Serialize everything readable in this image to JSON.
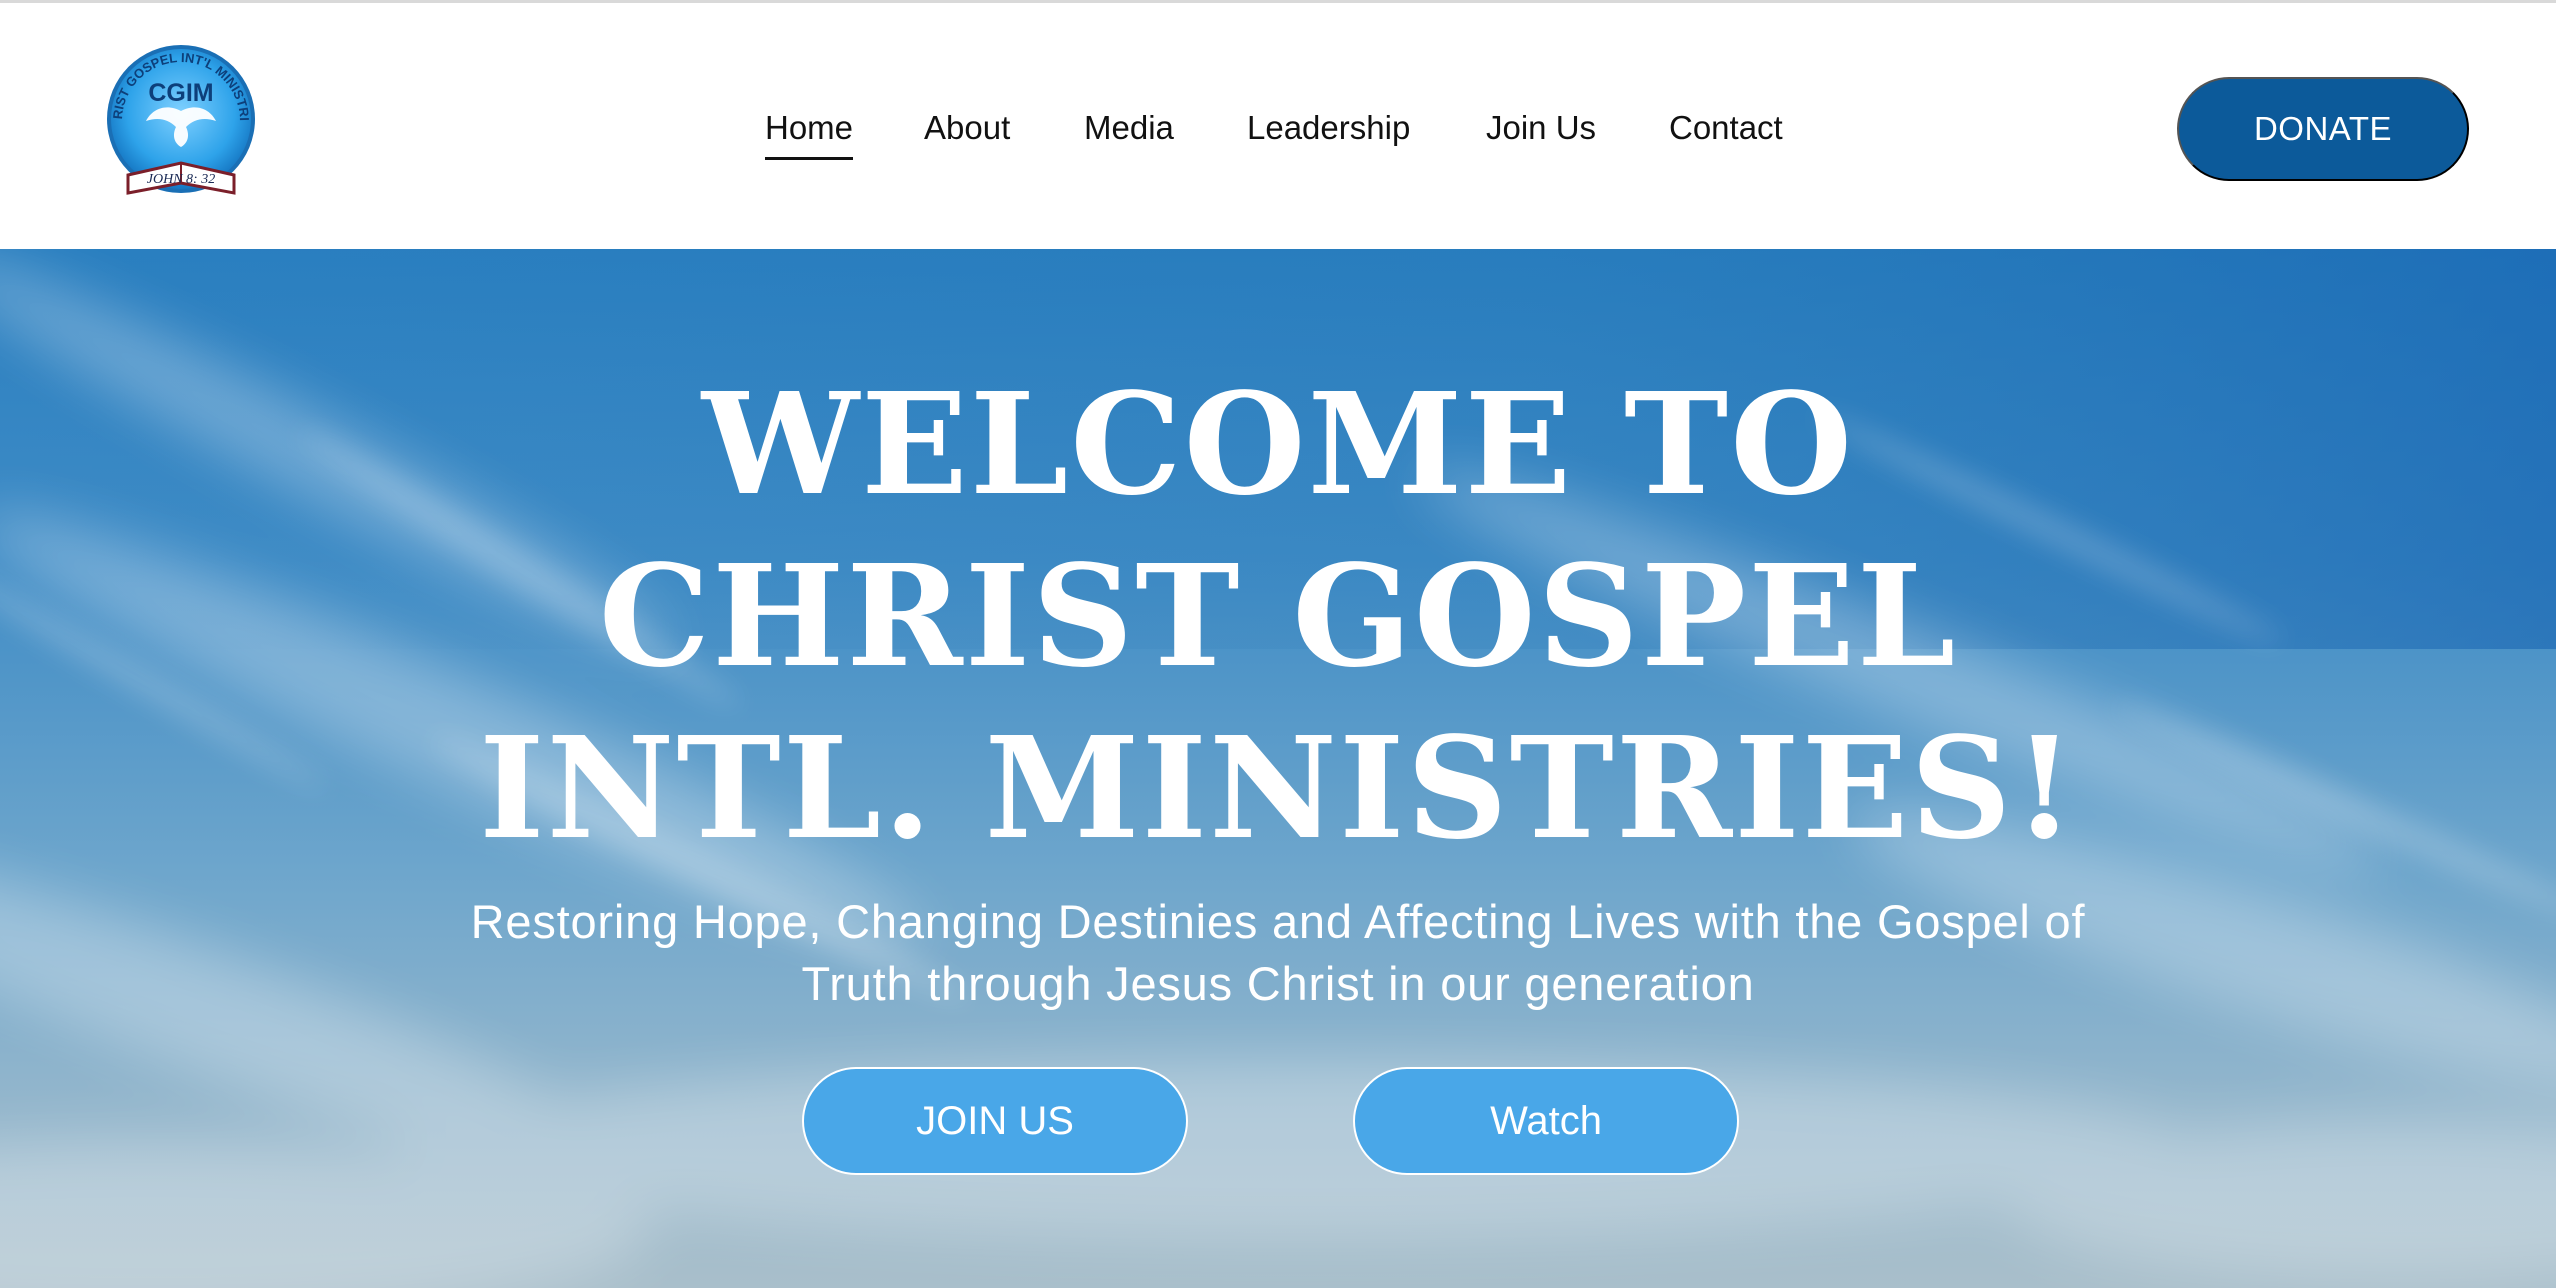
{
  "logo": {
    "ring_text": "CHRIST GOSPEL INT'L MINISTRIES",
    "monogram": "CGIM",
    "book_text": "JOHN 8: 32"
  },
  "nav": {
    "items": [
      {
        "label": "Home",
        "active": true
      },
      {
        "label": "About",
        "active": false
      },
      {
        "label": "Media",
        "active": false
      },
      {
        "label": "Leadership",
        "active": false
      },
      {
        "label": "Join Us",
        "active": false
      },
      {
        "label": "Contact",
        "active": false
      }
    ]
  },
  "donate_label": "DONATE",
  "hero": {
    "title_lines": [
      "WELCOME TO",
      "CHRIST GOSPEL",
      "INTL. MINISTRIES!"
    ],
    "subtitle_lines": [
      "Restoring Hope, Changing Destinies and Affecting Lives with the Gospel of",
      "Truth through Jesus Christ in our generation"
    ],
    "join_label": "JOIN US",
    "watch_label": "Watch"
  },
  "colors": {
    "donate_bg": "#0c5a9a",
    "hero_button_bg": "#49a7e8",
    "sky_top": "#2a7fc0",
    "sky_bottom": "#a9bfcb"
  }
}
